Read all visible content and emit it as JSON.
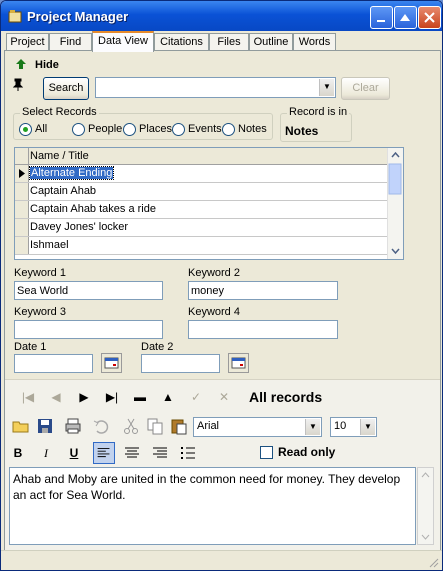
{
  "window": {
    "title": "Project Manager"
  },
  "tabs": [
    {
      "label": "Project"
    },
    {
      "label": "Find"
    },
    {
      "label": "Data View"
    },
    {
      "label": "Citations"
    },
    {
      "label": "Files"
    },
    {
      "label": "Outline"
    },
    {
      "label": "Words"
    }
  ],
  "active_tab": "Data View",
  "hide_label": "Hide",
  "search": {
    "button_label": "Search",
    "combo_value": "",
    "clear_label": "Clear"
  },
  "select_records": {
    "legend": "Select Records",
    "options": [
      {
        "label": "All",
        "checked": true
      },
      {
        "label": "People",
        "checked": false
      },
      {
        "label": "Places",
        "checked": false
      },
      {
        "label": "Events",
        "checked": false
      },
      {
        "label": "Notes",
        "checked": false
      }
    ]
  },
  "record_is_in": {
    "legend": "Record is in",
    "value": "Notes"
  },
  "grid": {
    "header": "Name / Title",
    "rows": [
      "Alternate Ending",
      "Captain Ahab",
      "Captain Ahab takes a ride",
      "Davey Jones' locker",
      "Ishmael"
    ],
    "selected_index": 0
  },
  "keywords": {
    "k1": {
      "label": "Keyword 1",
      "value": "Sea World"
    },
    "k2": {
      "label": "Keyword 2",
      "value": "money"
    },
    "k3": {
      "label": "Keyword 3",
      "value": ""
    },
    "k4": {
      "label": "Keyword 4",
      "value": ""
    }
  },
  "dates": {
    "d1": {
      "label": "Date 1",
      "value": ""
    },
    "d2": {
      "label": "Date 2",
      "value": ""
    }
  },
  "nav": {
    "status": "All records",
    "first": "|◀",
    "prev": "◀",
    "next": "▶",
    "last": "▶|",
    "delete": "▬",
    "up": "▲",
    "check": "✓",
    "cancel": "✕"
  },
  "format": {
    "font": "Arial",
    "size": "10",
    "read_only_label": "Read only",
    "bold": "B",
    "italic": "I",
    "underline": "U"
  },
  "memo": {
    "text": "Ahab and Moby are united in the common need for money.  They develop an act for Sea World."
  },
  "colors": {
    "titlebar": "#0a52d6",
    "selection": "#316ac5",
    "panel": "#ece9d8"
  }
}
